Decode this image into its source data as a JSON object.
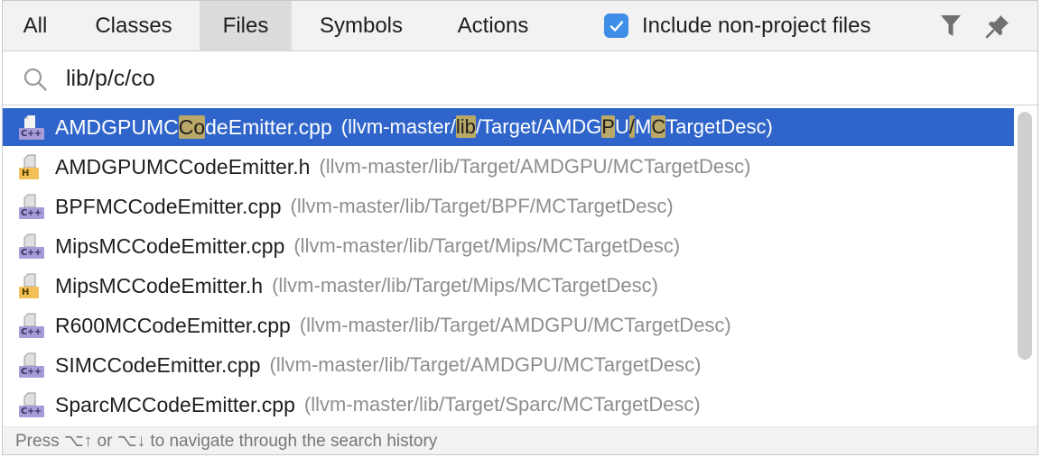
{
  "tabs": [
    {
      "label": "All",
      "selected": false
    },
    {
      "label": "Classes",
      "selected": false
    },
    {
      "label": "Files",
      "selected": true
    },
    {
      "label": "Symbols",
      "selected": false
    },
    {
      "label": "Actions",
      "selected": false
    }
  ],
  "include_option": {
    "label": "Include non-project files",
    "checked": true
  },
  "header_icons": [
    "filter-icon",
    "pin-icon"
  ],
  "search": {
    "value": "lib/p/c/co",
    "icon": "search-icon"
  },
  "results": [
    {
      "type": "cpp",
      "name_parts": [
        "AMDGPUMC",
        "Co",
        "deEmitter.cpp"
      ],
      "path_parts": [
        "(llvm-master/",
        "lib",
        "/Target/AMDG",
        "P",
        "U",
        "/",
        "M",
        "C",
        "TargetDesc)"
      ],
      "selected": true
    },
    {
      "type": "h",
      "name": "AMDGPUMCCodeEmitter.h",
      "path": "(llvm-master/lib/Target/AMDGPU/MCTargetDesc)"
    },
    {
      "type": "cpp",
      "name": "BPFMCCodeEmitter.cpp",
      "path": "(llvm-master/lib/Target/BPF/MCTargetDesc)"
    },
    {
      "type": "cpp",
      "name": "MipsMCCodeEmitter.cpp",
      "path": "(llvm-master/lib/Target/Mips/MCTargetDesc)"
    },
    {
      "type": "h",
      "name": "MipsMCCodeEmitter.h",
      "path": "(llvm-master/lib/Target/Mips/MCTargetDesc)"
    },
    {
      "type": "cpp",
      "name": "R600MCCodeEmitter.cpp",
      "path": "(llvm-master/lib/Target/AMDGPU/MCTargetDesc)"
    },
    {
      "type": "cpp",
      "name": "SIMCCodeEmitter.cpp",
      "path": "(llvm-master/lib/Target/AMDGPU/MCTargetDesc)"
    },
    {
      "type": "cpp",
      "name": "SparcMCCodeEmitter.cpp",
      "path": "(llvm-master/lib/Target/Sparc/MCTargetDesc)"
    }
  ],
  "badges": {
    "cpp": "C++",
    "h": "H"
  },
  "footer": {
    "hint": "Press ⌥↑ or ⌥↓ to navigate through the search history"
  },
  "colors": {
    "selection": "#2f65ca",
    "match_highlight": "#b9a868",
    "checkbox": "#3e8ee8",
    "path_text": "#8e8e8e"
  }
}
